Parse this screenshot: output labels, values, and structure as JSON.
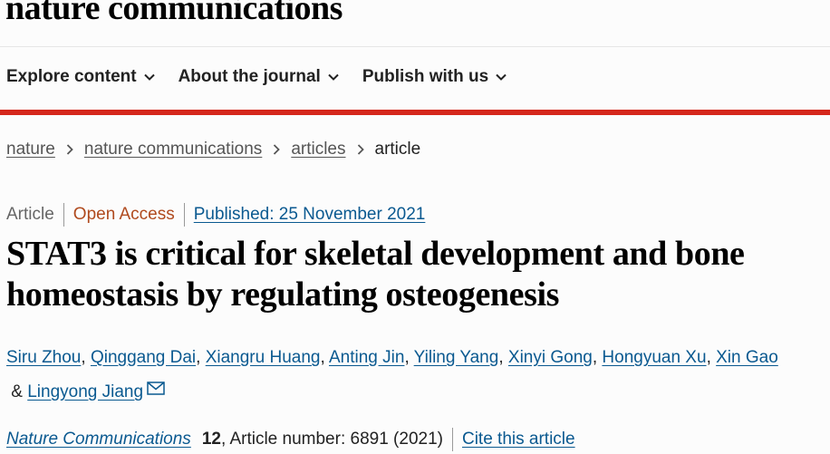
{
  "header": {
    "brand": "nature communications",
    "nav": [
      {
        "label": "Explore content"
      },
      {
        "label": "About the journal"
      },
      {
        "label": "Publish with us"
      }
    ]
  },
  "breadcrumb": {
    "links": [
      "nature",
      "nature communications",
      "articles"
    ],
    "current": "article"
  },
  "article": {
    "type": "Article",
    "access": "Open Access",
    "published": "Published: 25 November 2021",
    "title": "STAT3 is critical for skeletal development and bone homeostasis by regulating osteogenesis",
    "authors": [
      "Siru Zhou",
      "Qinggang Dai",
      "Xiangru Huang",
      "Anting Jin",
      "Yiling Yang",
      "Xinyi Gong",
      "Hongyuan Xu",
      "Xin Gao",
      "Lingyong Jiang"
    ],
    "author_sep": ", ",
    "author_last_sep": " & ",
    "journal": "Nature Communications",
    "volume": "12",
    "article_number": ", Article number: 6891 (2021)",
    "cite": "Cite this article"
  },
  "colors": {
    "accent_red": "#d5281c",
    "link_blue": "#0a5990",
    "open_access": "#b04a1e"
  },
  "icons": {
    "nav_chevron": "chevron-down-icon",
    "breadcrumb_sep": "chevron-right-icon",
    "corresponding": "mail-icon"
  }
}
